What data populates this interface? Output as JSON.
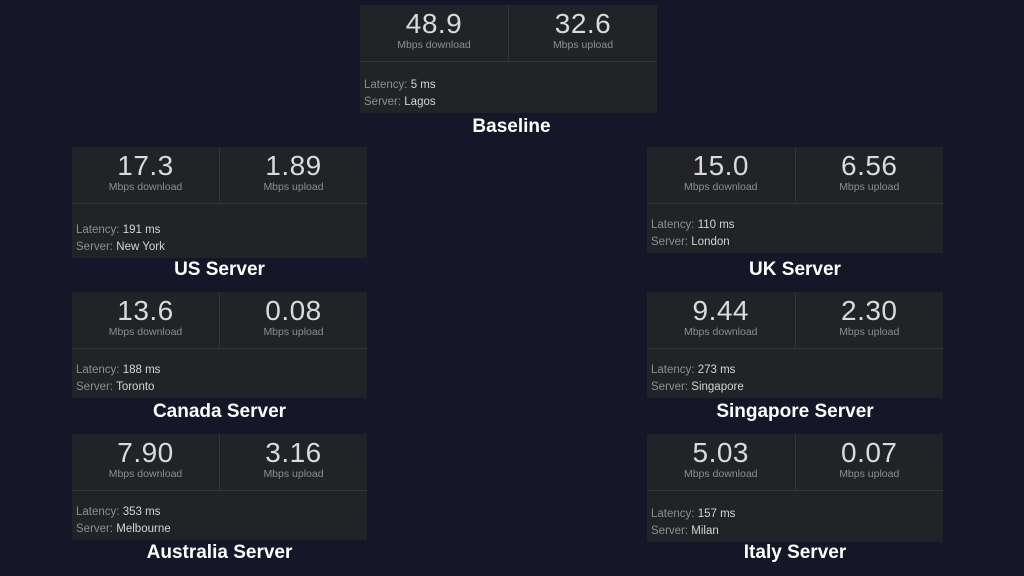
{
  "cards": [
    {
      "id": "baseline",
      "title": "Baseline",
      "download": "48.9",
      "upload": "32.6",
      "latency_label": "Latency:",
      "latency": "5 ms",
      "server_label": "Server:",
      "server": "Lagos"
    },
    {
      "id": "us",
      "title": "US Server",
      "download": "17.3",
      "upload": "1.89",
      "latency_label": "Latency:",
      "latency": "191 ms",
      "server_label": "Server:",
      "server": "New York"
    },
    {
      "id": "uk",
      "title": "UK Server",
      "download": "15.0",
      "upload": "6.56",
      "latency_label": "Latency:",
      "latency": "110 ms",
      "server_label": "Server:",
      "server": "London"
    },
    {
      "id": "canada",
      "title": "Canada Server",
      "download": "13.6",
      "upload": "0.08",
      "latency_label": "Latency:",
      "latency": "188 ms",
      "server_label": "Server:",
      "server": "Toronto"
    },
    {
      "id": "singapore",
      "title": "Singapore Server",
      "download": "9.44",
      "upload": "2.30",
      "latency_label": "Latency:",
      "latency": "273 ms",
      "server_label": "Server:",
      "server": "Singapore"
    },
    {
      "id": "australia",
      "title": "Australia Server",
      "download": "7.90",
      "upload": "3.16",
      "latency_label": "Latency:",
      "latency": "353 ms",
      "server_label": "Server:",
      "server": "Melbourne"
    },
    {
      "id": "italy",
      "title": "Italy Server",
      "download": "5.03",
      "upload": "0.07",
      "latency_label": "Latency:",
      "latency": "157 ms",
      "server_label": "Server:",
      "server": "Milan"
    }
  ],
  "units": {
    "download": "Mbps download",
    "upload": "Mbps upload"
  },
  "colors": {
    "background": "#151628",
    "card": "#222326",
    "value": "#dadada",
    "muted": "#8c8e92",
    "title": "#ffffff"
  }
}
